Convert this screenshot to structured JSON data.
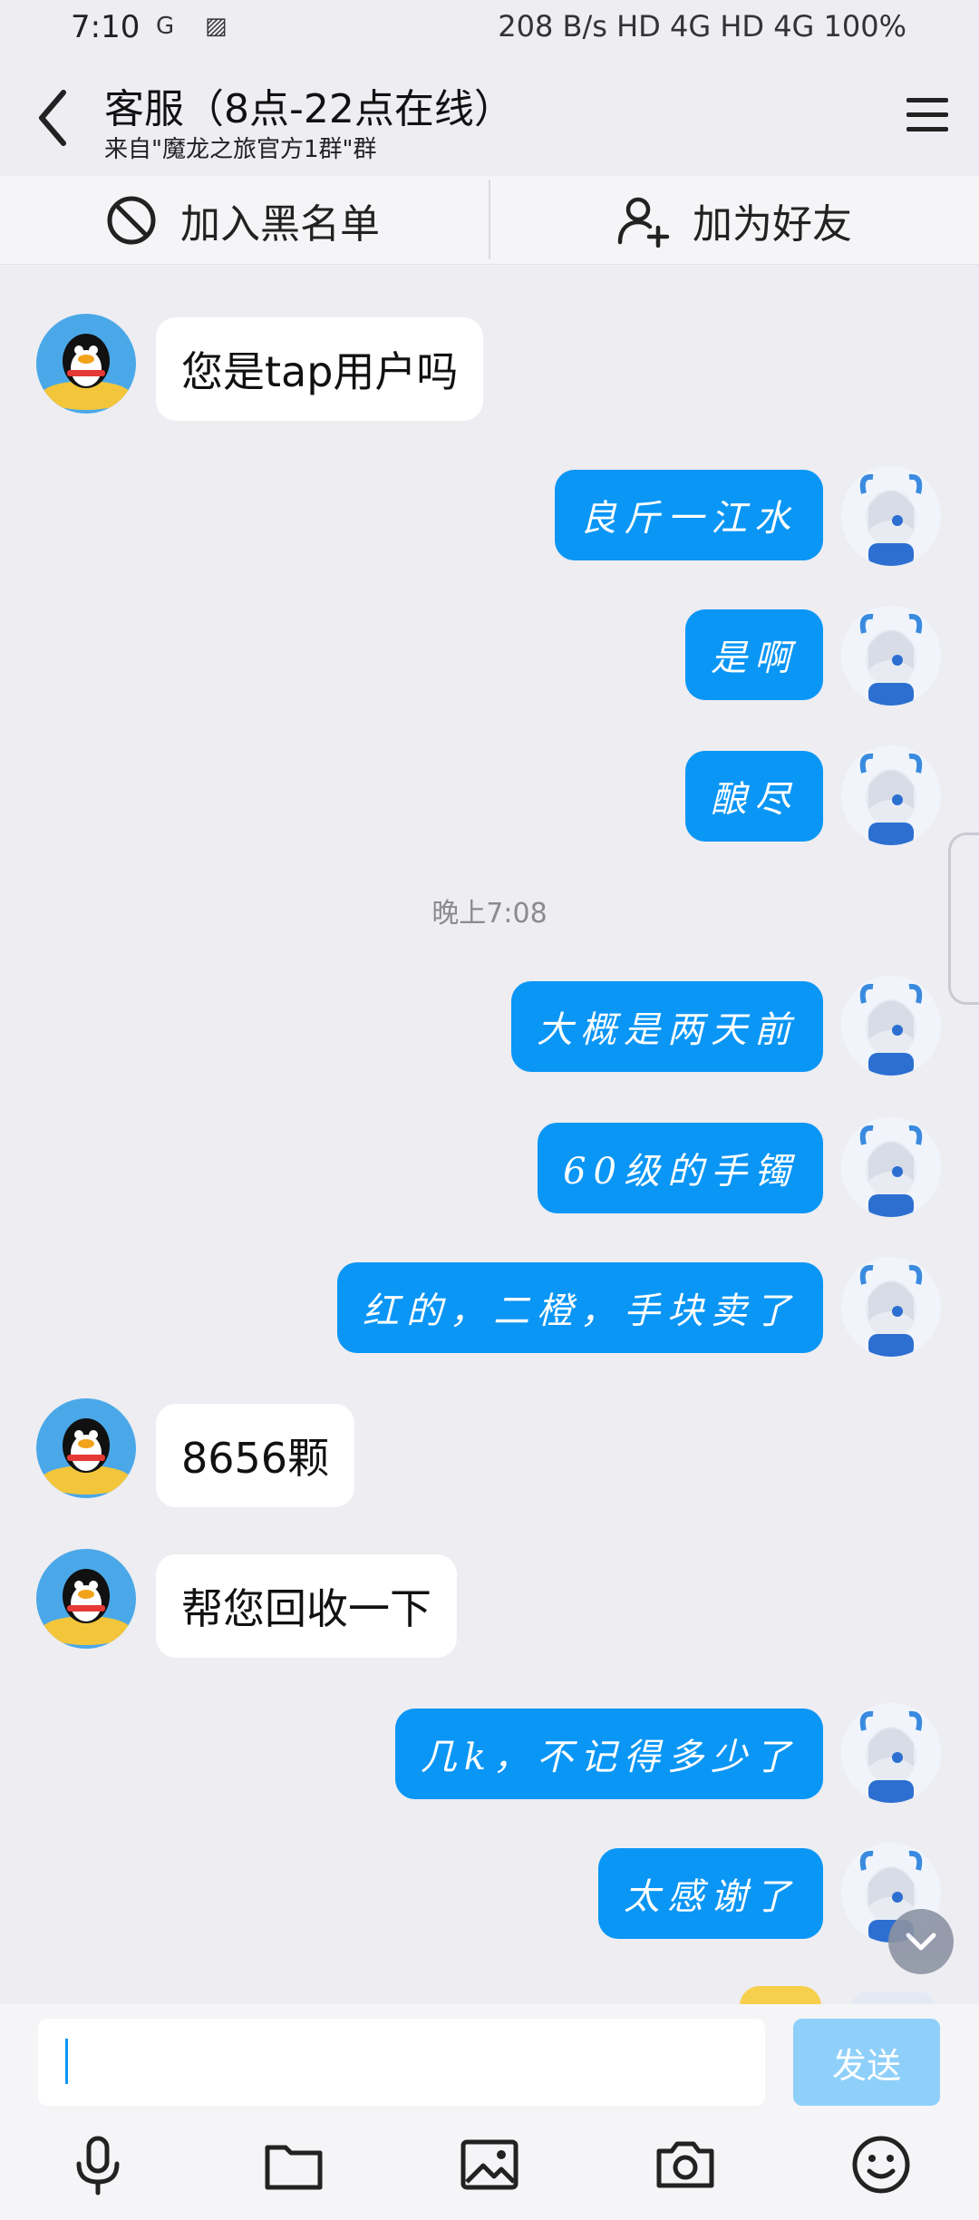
{
  "status_bar": {
    "time": "7:10",
    "right_text": "208 B/s  HD 4G  HD 4G  100%"
  },
  "header": {
    "title": "客服（8点-22点在线）",
    "subtitle": "来自\"魔龙之旅官方1群\"群"
  },
  "actions": {
    "blacklist_label": "加入黑名单",
    "add_friend_label": "加为好友"
  },
  "messages": [
    {
      "side": "in",
      "text": "您是tap用户吗"
    },
    {
      "side": "out",
      "text": "良斤一江水"
    },
    {
      "side": "out",
      "text": "是啊"
    },
    {
      "side": "out",
      "text": "酿尽"
    },
    {
      "side": "time",
      "text": "晚上7:08"
    },
    {
      "side": "out",
      "text": "大概是两天前"
    },
    {
      "side": "out",
      "text": "60级的手镯"
    },
    {
      "side": "out",
      "text": "红的，二橙，手块卖了"
    },
    {
      "side": "in",
      "text": "8656颗"
    },
    {
      "side": "in",
      "text": "帮您回收一下"
    },
    {
      "side": "out",
      "text": "几k，不记得多少了"
    },
    {
      "side": "out",
      "text": "太感谢了"
    }
  ],
  "input": {
    "value": "",
    "send_label": "发送"
  },
  "colors": {
    "accent": "#0A96F5",
    "background": "#EDEDF2",
    "send_disabled": "#8FD0FA"
  },
  "icons": [
    "back-icon",
    "menu-icon",
    "block-icon",
    "add-person-icon",
    "microphone-icon",
    "folder-icon",
    "image-icon",
    "camera-icon",
    "emoji-icon",
    "chevron-down-icon"
  ]
}
